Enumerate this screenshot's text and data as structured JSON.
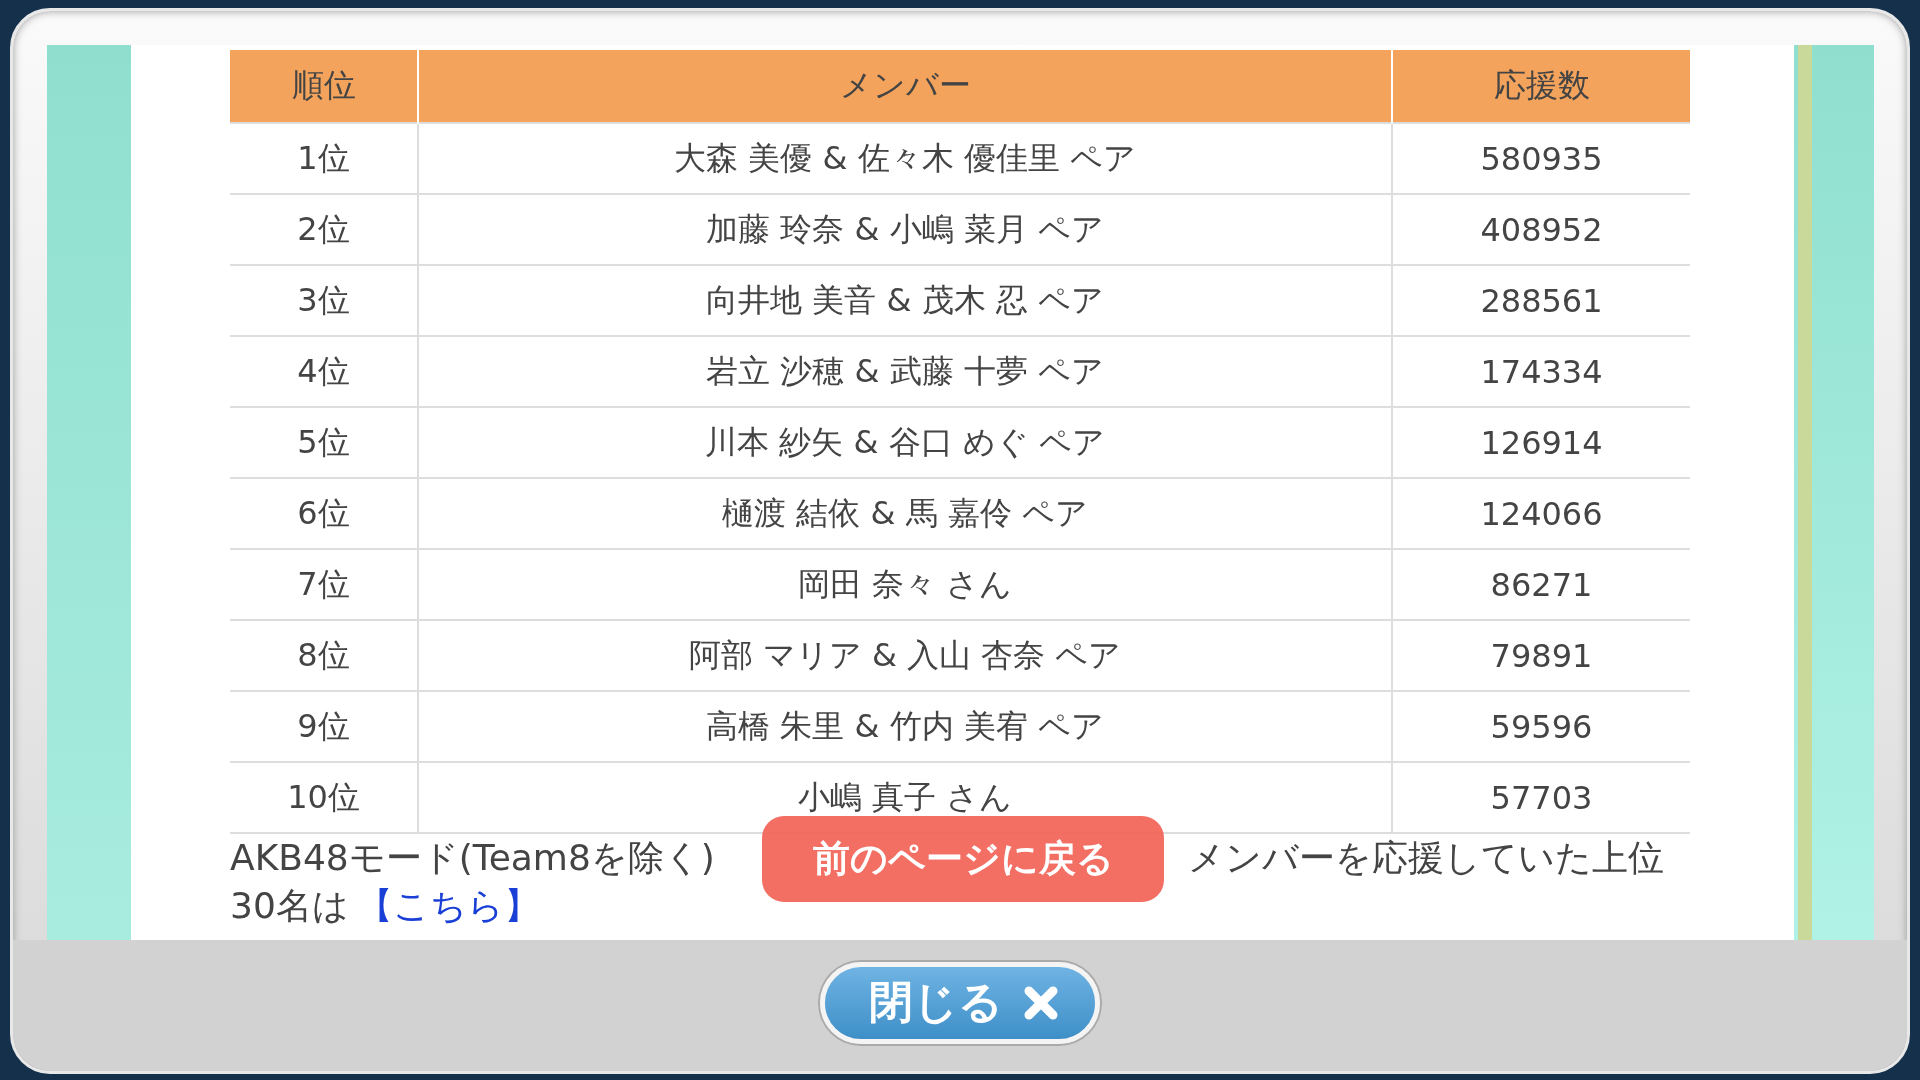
{
  "table": {
    "columns": [
      "順位",
      "メンバー",
      "応援数"
    ],
    "rows": [
      {
        "rank": "1位",
        "member": "大森 美優 & 佐々木 優佳里 ペア",
        "votes": "580935"
      },
      {
        "rank": "2位",
        "member": "加藤 玲奈 & 小嶋 菜月 ペア",
        "votes": "408952"
      },
      {
        "rank": "3位",
        "member": "向井地 美音 & 茂木 忍 ペア",
        "votes": "288561"
      },
      {
        "rank": "4位",
        "member": "岩立 沙穂 & 武藤 十夢 ペア",
        "votes": "174334"
      },
      {
        "rank": "5位",
        "member": "川本 紗矢 & 谷口 めぐ ペア",
        "votes": "126914"
      },
      {
        "rank": "6位",
        "member": "樋渡 結依 & 馬 嘉伶 ペア",
        "votes": "124066"
      },
      {
        "rank": "7位",
        "member": "岡田 奈々 さん",
        "votes": "86271"
      },
      {
        "rank": "8位",
        "member": "阿部 マリア & 入山 杏奈 ペア",
        "votes": "79891"
      },
      {
        "rank": "9位",
        "member": "高橋 朱里 & 竹内 美宥 ペア",
        "votes": "59596"
      },
      {
        "rank": "10位",
        "member": "小嶋 真子 さん",
        "votes": "57703"
      }
    ]
  },
  "note": {
    "before": "AKB48モード(Team8を除く)",
    "after": "メンバーを応援していた上位",
    "line2": "30名は",
    "link": "【こちら】"
  },
  "back_button": "前のページに戻る",
  "close_button": {
    "label": "閉じる"
  }
}
